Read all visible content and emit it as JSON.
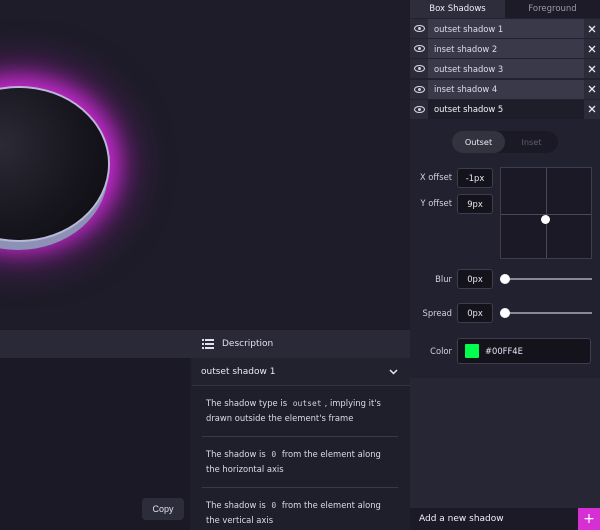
{
  "tabs": [
    {
      "label": "Box Shadows",
      "active": true
    },
    {
      "label": "Foreground",
      "active": false
    }
  ],
  "shadows": [
    {
      "name": "outset shadow 1"
    },
    {
      "name": "inset shadow 2"
    },
    {
      "name": "outset shadow 3"
    },
    {
      "name": "inset shadow 4"
    },
    {
      "name": "outset shadow 5",
      "selected": true
    }
  ],
  "toggle": {
    "outset": "Outset",
    "inset": "Inset"
  },
  "fields": {
    "x_offset_label": "X offset",
    "x_offset_value": "-1px",
    "y_offset_label": "Y offset",
    "y_offset_value": "9px",
    "blur_label": "Blur",
    "blur_value": "0px",
    "spread_label": "Spread",
    "spread_value": "0px",
    "color_label": "Color",
    "color_value": "#00FF4E"
  },
  "colors": {
    "swatch": "#00FF4E",
    "accent": "#d62fd4"
  },
  "add_shadow_label": "Add a new shadow",
  "add_icon": "plus-icon",
  "copy_label": "Copy",
  "description": {
    "header": "Description",
    "selected": "outset shadow 1",
    "items": [
      {
        "pre": "The shadow type is ",
        "code": "outset",
        "post": ", implying it's drawn outside the element's frame"
      },
      {
        "pre": "The shadow is ",
        "code": "0",
        "post": " from the element along the horizontal axis"
      },
      {
        "pre": "The shadow is ",
        "code": "0",
        "post": " from the element along the vertical axis"
      }
    ]
  }
}
